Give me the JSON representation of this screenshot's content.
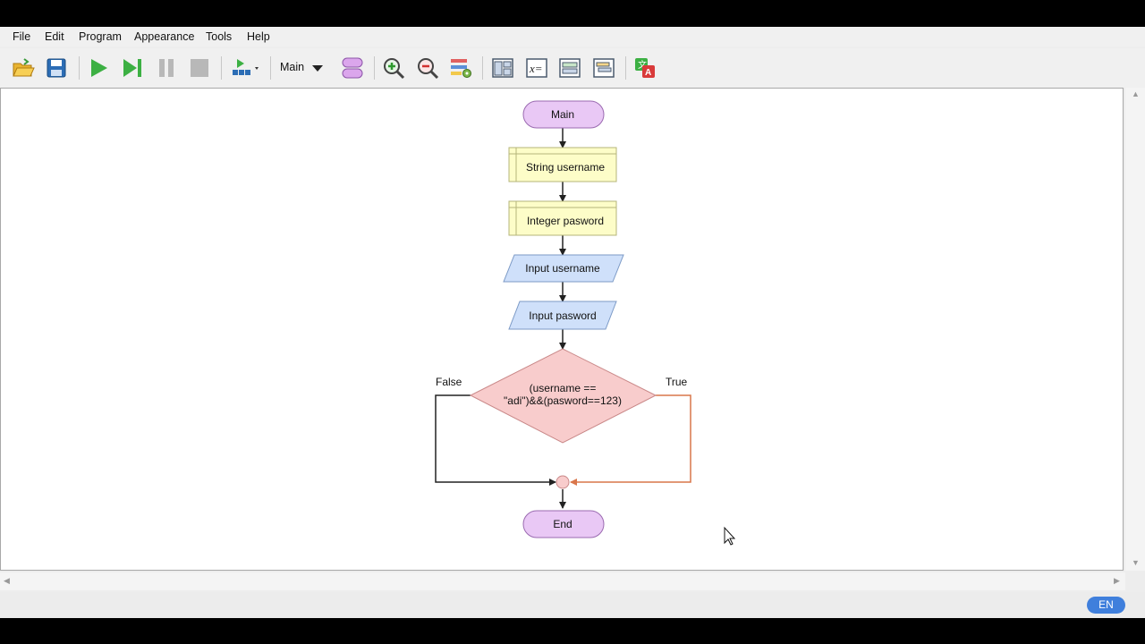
{
  "menu": [
    "File",
    "Edit",
    "Program",
    "Appearance",
    "Tools",
    "Help"
  ],
  "toolbar": {
    "function_selector": "Main"
  },
  "flowchart": {
    "start": "Main",
    "declare_1": "String username",
    "declare_2": "Integer pasword",
    "input_1": "Input username",
    "input_2": "Input pasword",
    "condition_line_1": "(username ==",
    "condition_line_2": "\"adi\")&&(pasword==123)",
    "false_label": "False",
    "true_label": "True",
    "end": "End"
  },
  "colors": {
    "terminal": "#e9c8f5",
    "declare": "#fdfdc8",
    "io": "#cfe0fa",
    "decision": "#f8cccc",
    "true_branch": "#d9764a",
    "language_badge": "#3f7fdc"
  },
  "status": {
    "language": "EN"
  }
}
